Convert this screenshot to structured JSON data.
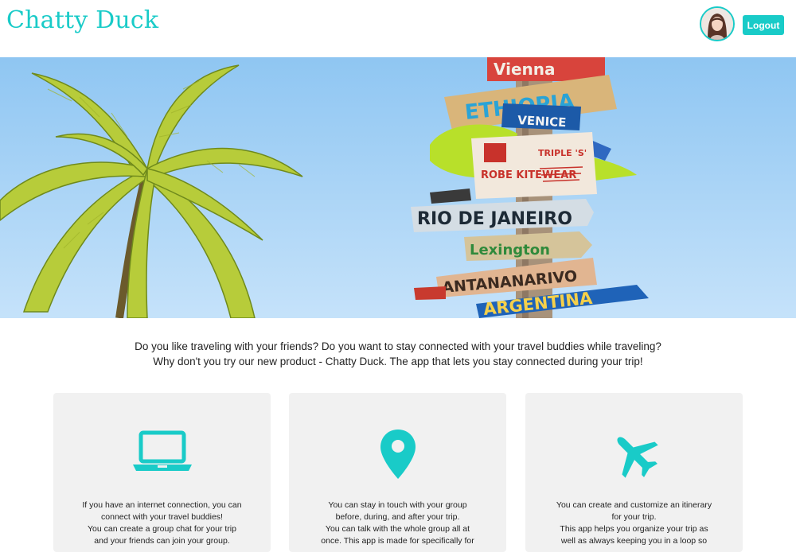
{
  "header": {
    "brand": "Chatty Duck",
    "logout_label": "Logout",
    "accent_color": "#19cbc8"
  },
  "hero": {
    "image_icon": "travel-signpost-palm-image",
    "signs": [
      "Vienna",
      "ETHIOPIA",
      "VENICE",
      "ROBE KITEWEAR",
      "TRIPLE 'S'",
      "RIO DE JANEIRO",
      "Lexington",
      "ANTANANARIVO",
      "ARGENTINA"
    ]
  },
  "intro": {
    "line1": "Do you like traveling with your friends? Do you want to stay connected with your travel buddies while traveling?",
    "line2": "Why don't you try our new product - Chatty Duck. The app that lets you stay connected during your trip!"
  },
  "features": [
    {
      "icon": "laptop-icon",
      "lines": [
        "If you have an internet connection, you can",
        "connect with your travel buddies!",
        "You can create a group chat for your trip",
        "and your friends can join your group."
      ]
    },
    {
      "icon": "map-pin-icon",
      "lines": [
        "You can stay in touch with your group",
        "before, during, and after your trip.",
        "You can talk with the whole group all at",
        "once. This app is made for specifically for"
      ]
    },
    {
      "icon": "airplane-icon",
      "lines": [
        "You can create and customize an itinerary",
        "for your trip.",
        "This app helps you organize your trip as",
        "well as always keeping you in a loop so"
      ]
    }
  ]
}
